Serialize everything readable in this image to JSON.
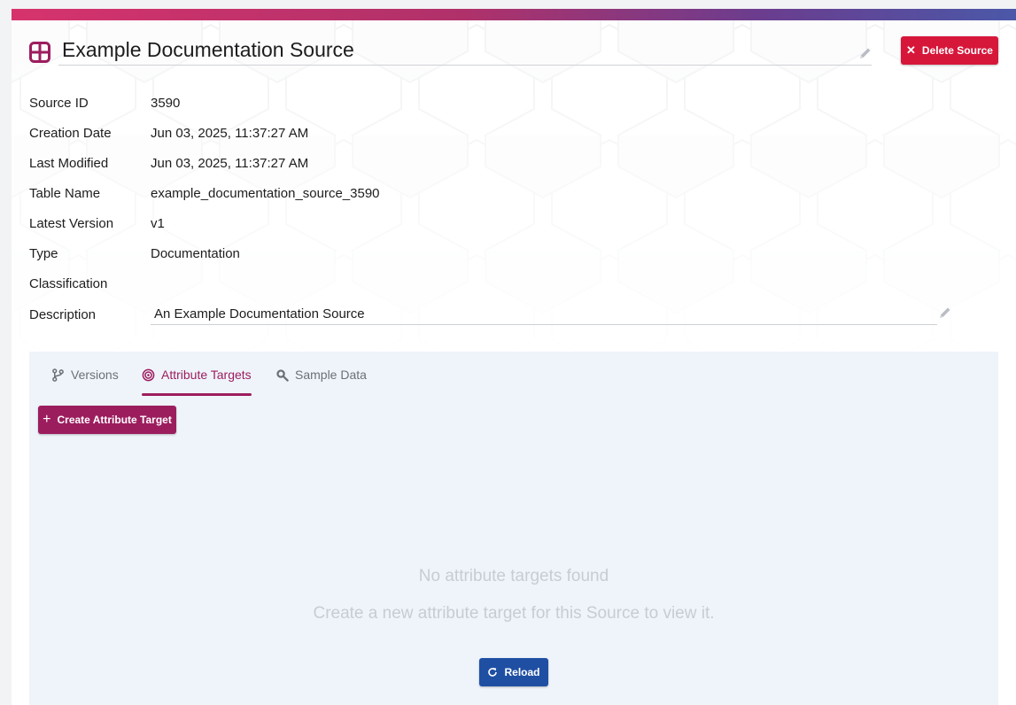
{
  "header": {
    "title": "Example Documentation Source",
    "delete_label": "Delete Source",
    "icon": "table-grid-icon",
    "accent_color": "#9c1d5e",
    "danger_color": "#d6173a"
  },
  "metadata": [
    {
      "label": "Source ID",
      "value": "3590"
    },
    {
      "label": "Creation Date",
      "value": "Jun 03, 2025, 11:37:27 AM"
    },
    {
      "label": "Last Modified",
      "value": "Jun 03, 2025, 11:37:27 AM"
    },
    {
      "label": "Table Name",
      "value": "example_documentation_source_3590"
    },
    {
      "label": "Latest Version",
      "value": "v1"
    },
    {
      "label": "Type",
      "value": "Documentation"
    },
    {
      "label": "Classification",
      "value": ""
    },
    {
      "label": "Description",
      "value": "An Example Documentation Source"
    }
  ],
  "tabs": [
    {
      "label": "Versions",
      "icon": "branch-icon",
      "active": false
    },
    {
      "label": "Attribute Targets",
      "icon": "target-icon",
      "active": true
    },
    {
      "label": "Sample Data",
      "icon": "magnify-icon",
      "active": false
    }
  ],
  "panel": {
    "create_label": "Create Attribute Target",
    "empty_title": "No attribute targets found",
    "empty_subtitle": "Create a new attribute target for this Source to view it.",
    "reload_label": "Reload",
    "reload_color": "#1f4fa3"
  }
}
